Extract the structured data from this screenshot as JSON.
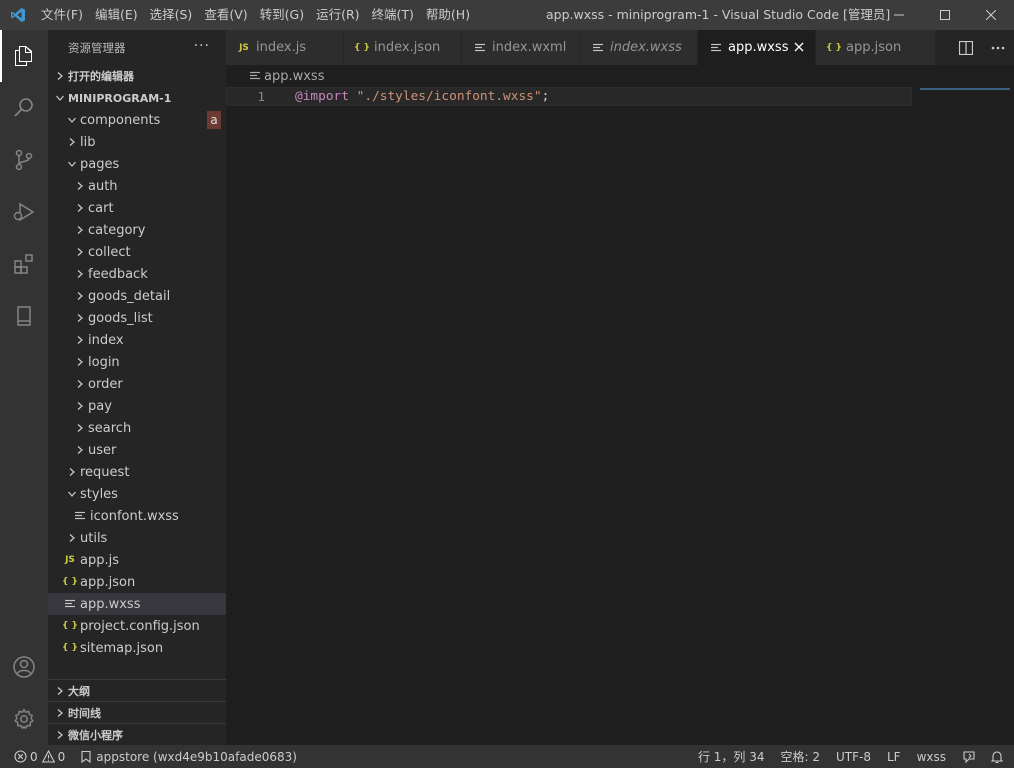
{
  "window": {
    "title": "app.wxss - miniprogram-1 - Visual Studio Code [管理员]"
  },
  "menu": [
    "文件(F)",
    "编辑(E)",
    "选择(S)",
    "查看(V)",
    "转到(G)",
    "运行(R)",
    "终端(T)",
    "帮助(H)"
  ],
  "colors": {
    "accent": "#007acc",
    "json_icon": "#cbcb41",
    "js_icon": "#cbcb41",
    "keyword": "#c586c0",
    "string": "#ce9178"
  },
  "sidebar": {
    "title": "资源管理器",
    "more": "···",
    "open_editors": "打开的编辑器",
    "project": "MINIPROGRAM-1",
    "badge": "a",
    "tree": [
      {
        "label": "components",
        "depth": 0,
        "kind": "folder-open",
        "icon": "chevron-down-icon"
      },
      {
        "label": "lib",
        "depth": 0,
        "kind": "folder",
        "icon": "chevron-right-icon"
      },
      {
        "label": "pages",
        "depth": 0,
        "kind": "folder-open",
        "icon": "chevron-down-icon"
      },
      {
        "label": "auth",
        "depth": 1,
        "kind": "folder",
        "icon": "chevron-right-icon"
      },
      {
        "label": "cart",
        "depth": 1,
        "kind": "folder",
        "icon": "chevron-right-icon"
      },
      {
        "label": "category",
        "depth": 1,
        "kind": "folder",
        "icon": "chevron-right-icon"
      },
      {
        "label": "collect",
        "depth": 1,
        "kind": "folder",
        "icon": "chevron-right-icon"
      },
      {
        "label": "feedback",
        "depth": 1,
        "kind": "folder",
        "icon": "chevron-right-icon"
      },
      {
        "label": "goods_detail",
        "depth": 1,
        "kind": "folder",
        "icon": "chevron-right-icon"
      },
      {
        "label": "goods_list",
        "depth": 1,
        "kind": "folder",
        "icon": "chevron-right-icon"
      },
      {
        "label": "index",
        "depth": 1,
        "kind": "folder",
        "icon": "chevron-right-icon"
      },
      {
        "label": "login",
        "depth": 1,
        "kind": "folder",
        "icon": "chevron-right-icon"
      },
      {
        "label": "order",
        "depth": 1,
        "kind": "folder",
        "icon": "chevron-right-icon"
      },
      {
        "label": "pay",
        "depth": 1,
        "kind": "folder",
        "icon": "chevron-right-icon"
      },
      {
        "label": "search",
        "depth": 1,
        "kind": "folder",
        "icon": "chevron-right-icon"
      },
      {
        "label": "user",
        "depth": 1,
        "kind": "folder",
        "icon": "chevron-right-icon"
      },
      {
        "label": "request",
        "depth": 0,
        "kind": "folder",
        "icon": "chevron-right-icon"
      },
      {
        "label": "styles",
        "depth": 0,
        "kind": "folder-open",
        "icon": "chevron-down-icon"
      },
      {
        "label": "iconfont.wxss",
        "depth": 1,
        "kind": "wxss",
        "icon": "wxss-file-icon"
      },
      {
        "label": "utils",
        "depth": 0,
        "kind": "folder",
        "icon": "chevron-right-icon"
      },
      {
        "label": "app.js",
        "depth": -1,
        "kind": "js",
        "icon": "js-file-icon"
      },
      {
        "label": "app.json",
        "depth": -1,
        "kind": "json",
        "icon": "json-file-icon"
      },
      {
        "label": "app.wxss",
        "depth": -1,
        "kind": "wxss",
        "icon": "wxss-file-icon",
        "selected": true
      },
      {
        "label": "project.config.json",
        "depth": -1,
        "kind": "json",
        "icon": "json-file-icon"
      },
      {
        "label": "sitemap.json",
        "depth": -1,
        "kind": "json",
        "icon": "json-file-icon"
      }
    ],
    "bottom_sections": [
      "大纲",
      "时间线",
      "微信小程序"
    ]
  },
  "tabs": [
    {
      "label": "index.js",
      "kind": "js",
      "icon": "js-file-icon",
      "italic": false
    },
    {
      "label": "index.json",
      "kind": "json",
      "icon": "json-file-icon",
      "italic": false
    },
    {
      "label": "index.wxml",
      "kind": "wxss",
      "icon": "wxml-file-icon",
      "italic": false
    },
    {
      "label": "index.wxss",
      "kind": "wxss",
      "icon": "wxss-file-icon",
      "italic": true
    },
    {
      "label": "app.wxss",
      "kind": "wxss",
      "icon": "wxss-file-icon",
      "italic": false,
      "active": true
    },
    {
      "label": "app.json",
      "kind": "json",
      "icon": "json-file-icon",
      "italic": false
    }
  ],
  "breadcrumb": "app.wxss",
  "editor": {
    "line_number": "1",
    "keyword": "@import",
    "space": " ",
    "string": "\"./styles/iconfont.wxss\"",
    "punct": ";"
  },
  "status": {
    "errors": "0",
    "warnings": "0",
    "appstore": "appstore (wxd4e9b10afade0683)",
    "position": "行 1，列 34",
    "spaces": "空格: 2",
    "encoding": "UTF-8",
    "eol": "LF",
    "language": "wxss"
  }
}
